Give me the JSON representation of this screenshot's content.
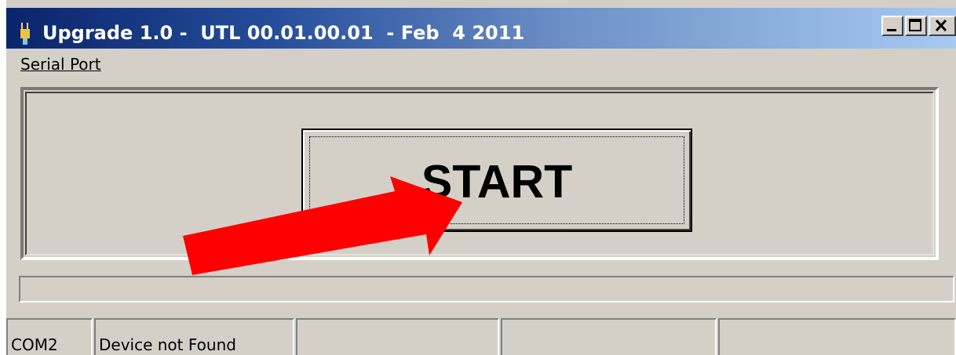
{
  "window": {
    "title": "Upgrade 1.0 -  UTL 00.01.00.01  - Feb  4 2011",
    "controls": {
      "minimize_icon": "minimize-icon",
      "maximize_icon": "maximize-icon",
      "close_icon": "close-icon"
    }
  },
  "menu": {
    "items": [
      {
        "label": "Serial Port",
        "accelerator": "S"
      }
    ]
  },
  "main": {
    "start_button": {
      "label": "START"
    },
    "progress": {
      "value": 0
    }
  },
  "status_bar": {
    "panes": [
      "COM2",
      "Device not Found",
      "",
      "",
      ""
    ]
  },
  "annotation": {
    "icon": "red-arrow",
    "color": "#ff0000"
  },
  "colors": {
    "window_bg": "#d4d0c8",
    "title_start": "#0a246a",
    "title_end": "#a6caf0",
    "arrow": "#ff0000"
  }
}
